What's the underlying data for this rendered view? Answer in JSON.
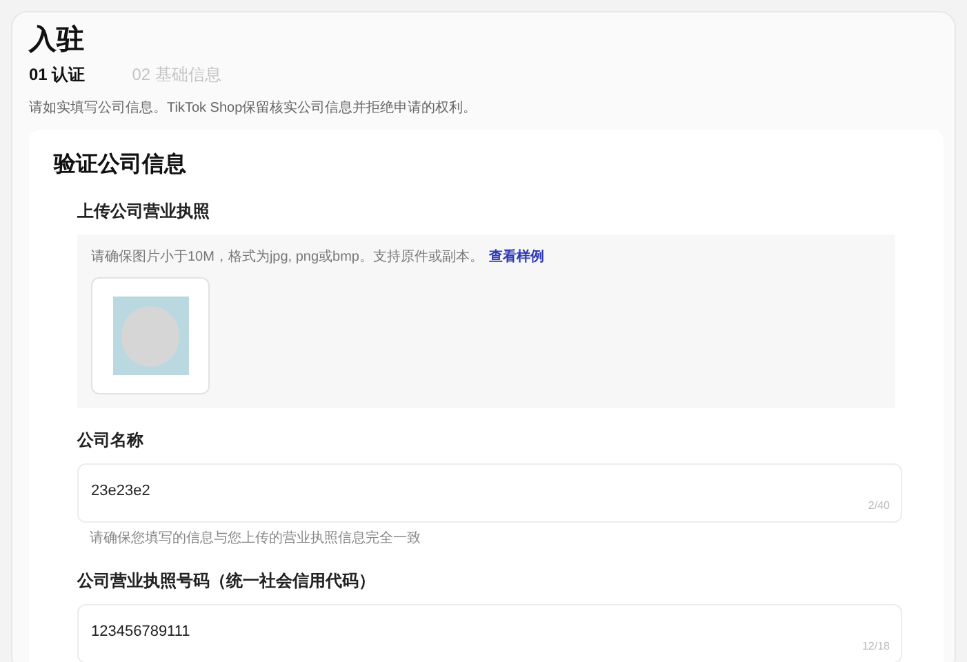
{
  "page": {
    "title": "入驻"
  },
  "steps": [
    {
      "label": "01 认证",
      "selected": true
    },
    {
      "label": "02 基础信息",
      "selected": false
    }
  ],
  "notice": "请如实填写公司信息。TikTok Shop保留核实公司信息并拒绝申请的权利。",
  "section": {
    "title": "验证公司信息",
    "upload": {
      "label": "上传公司营业执照",
      "hint": "请确保图片小于10M，格式为jpg, png或bmp。支持原件或副本。",
      "link": "查看样例"
    },
    "fields": [
      {
        "label": "公司名称",
        "value": "23e23e2",
        "counter": "2/40",
        "helper": "请确保您填写的信息与您上传的营业执照信息完全一致"
      },
      {
        "label": "公司营业执照号码（统一社会信用代码）",
        "value": "123456789111",
        "counter": "12/18"
      }
    ]
  }
}
